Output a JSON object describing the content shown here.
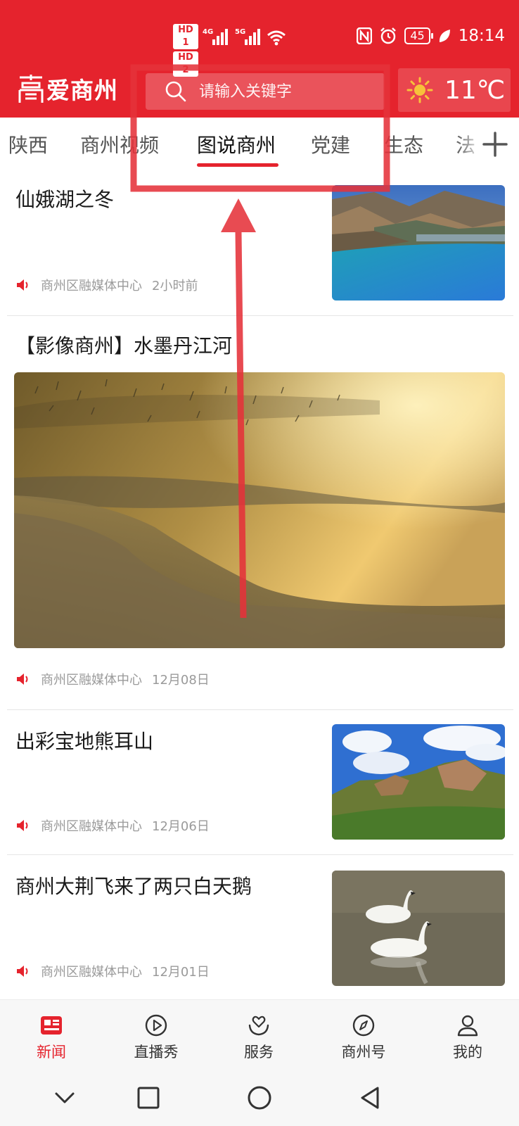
{
  "status_bar": {
    "hd1": "HD 1",
    "hd2": "HD 2",
    "net1": "4G",
    "net2": "5G",
    "battery": "45",
    "time": "18:14"
  },
  "header": {
    "logo_text": "爱商州",
    "search_placeholder": "请输入关键字",
    "temperature": "11℃",
    "weather_icon": "sun-icon",
    "brand_color": "#e5232d"
  },
  "tabs": [
    {
      "label": "陕西",
      "active": false
    },
    {
      "label": "商州视频",
      "active": false
    },
    {
      "label": "图说商州",
      "active": true
    },
    {
      "label": "党建",
      "active": false
    },
    {
      "label": "生态",
      "active": false
    },
    {
      "label": "法",
      "active": false
    }
  ],
  "feed": [
    {
      "title": "仙娥湖之冬",
      "source": "商州区融媒体中心",
      "time": "2小时前",
      "layout": "thumb-right"
    },
    {
      "title": "【影像商州】水墨丹江河",
      "source": "商州区融媒体中心",
      "time": "12月08日",
      "layout": "big-image"
    },
    {
      "title": "出彩宝地熊耳山",
      "source": "商州区融媒体中心",
      "time": "12月06日",
      "layout": "thumb-right"
    },
    {
      "title": "商州大荆飞来了两只白天鹅",
      "source": "商州区融媒体中心",
      "time": "12月01日",
      "layout": "thumb-right"
    }
  ],
  "bottom_nav": [
    {
      "label": "新闻",
      "icon": "news-icon",
      "active": true
    },
    {
      "label": "直播秀",
      "icon": "play-icon",
      "active": false
    },
    {
      "label": "服务",
      "icon": "service-icon",
      "active": false
    },
    {
      "label": "商州号",
      "icon": "compass-icon",
      "active": false
    },
    {
      "label": "我的",
      "icon": "user-icon",
      "active": false
    }
  ],
  "annotation": {
    "highlight_color": "#e5323a"
  }
}
